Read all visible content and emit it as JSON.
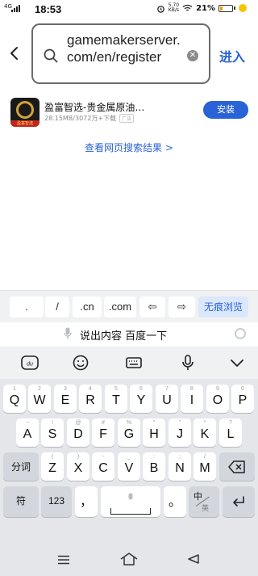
{
  "status_bar": {
    "network": "4G",
    "time": "18:53",
    "speed_value": "5.70",
    "speed_unit": "KB/s",
    "battery": "21%"
  },
  "search": {
    "query": "gamemakerserver.com/en/register",
    "enter_label": "进入"
  },
  "app_result": {
    "title": "盈富智选-贵金属原油…",
    "meta": "28.15MB/3072万+下载",
    "tag": "广告",
    "icon_caption": "盈富智选",
    "install_label": "安装"
  },
  "web_search_link": "查看网页搜索结果",
  "suggestion_keys": [
    ".",
    "/",
    ".cn",
    ".com",
    "⇦",
    "⇨",
    "无痕浏览"
  ],
  "voice_bar": {
    "text": "说出内容 百度一下"
  },
  "keyboard": {
    "row1": [
      {
        "main": "Q",
        "sub": "1"
      },
      {
        "main": "W",
        "sub": "2"
      },
      {
        "main": "E",
        "sub": "3"
      },
      {
        "main": "R",
        "sub": "4"
      },
      {
        "main": "T",
        "sub": "5"
      },
      {
        "main": "Y",
        "sub": "6"
      },
      {
        "main": "U",
        "sub": "7"
      },
      {
        "main": "I",
        "sub": "8"
      },
      {
        "main": "O",
        "sub": "9"
      },
      {
        "main": "P",
        "sub": "0"
      }
    ],
    "row2": [
      {
        "main": "A",
        "sub": "~"
      },
      {
        "main": "S",
        "sub": "!"
      },
      {
        "main": "D",
        "sub": "@"
      },
      {
        "main": "F",
        "sub": "#"
      },
      {
        "main": "G",
        "sub": "%"
      },
      {
        "main": "H",
        "sub": "\""
      },
      {
        "main": "J",
        "sub": "\""
      },
      {
        "main": "K",
        "sub": "*"
      },
      {
        "main": "L",
        "sub": "?"
      }
    ],
    "row3_left": "分词",
    "row3": [
      {
        "main": "Z",
        "sub": "("
      },
      {
        "main": "X",
        "sub": ")"
      },
      {
        "main": "C",
        "sub": "-"
      },
      {
        "main": "V",
        "sub": "_"
      },
      {
        "main": "B",
        "sub": ":"
      },
      {
        "main": "N",
        "sub": ";"
      },
      {
        "main": "M",
        "sub": "/"
      }
    ],
    "symbol_key": "符",
    "num_key": "123",
    "comma_key": "，",
    "period_key": "。",
    "lang_key_top": "中",
    "lang_key_bottom": "英"
  }
}
